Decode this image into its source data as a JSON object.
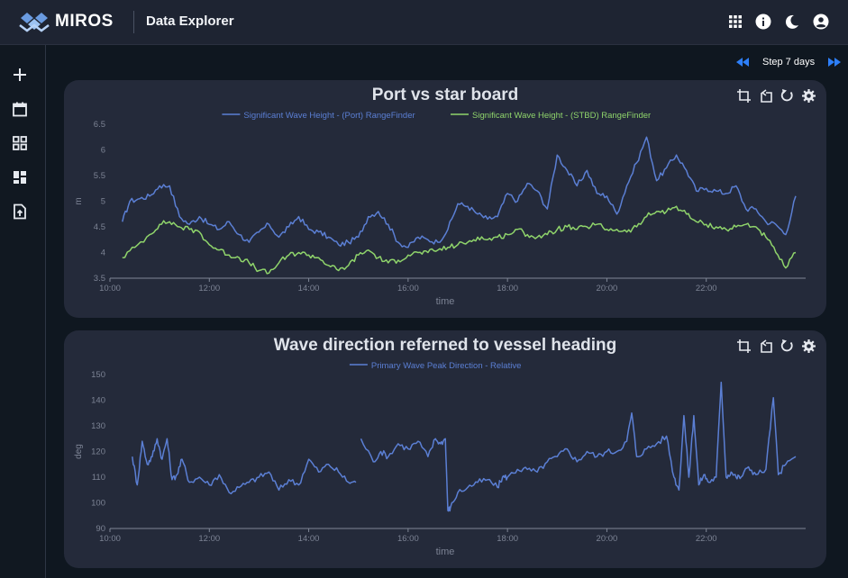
{
  "app": {
    "brand": "MIROS",
    "title": "Data Explorer"
  },
  "header": {
    "icons": [
      "apps-grid-icon",
      "info-icon",
      "dark-mode-moon-icon",
      "account-icon"
    ]
  },
  "sidebar": {
    "items": [
      {
        "icon": "add-icon"
      },
      {
        "icon": "calendar-icon"
      },
      {
        "icon": "grid-view-icon"
      },
      {
        "icon": "dashboard-icon"
      },
      {
        "icon": "upload-file-icon"
      }
    ]
  },
  "step": {
    "label": "Step 7 days"
  },
  "colors": {
    "accent": "#2d7ff9",
    "series_blue": "#5b7fd4",
    "series_green": "#8fd46b",
    "card_bg": "#242a3a",
    "axis_text": "#7c8394"
  },
  "chart_data": [
    {
      "type": "line",
      "title": "Port vs star board",
      "xlabel": "time",
      "ylabel": "m",
      "xlim": [
        10.0,
        24.0
      ],
      "ylim": [
        3.5,
        6.5
      ],
      "x_ticks": [
        "10:00",
        "12:00",
        "14:00",
        "16:00",
        "18:00",
        "20:00",
        "22:00"
      ],
      "y_ticks": [
        "3.5",
        "4",
        "4.5",
        "5",
        "5.5",
        "6",
        "6.5"
      ],
      "legend_position": "top-center",
      "series": [
        {
          "name": "Significant Wave Height - (Port) RangeFinder",
          "color": "#5b7fd4",
          "x": [
            10.25,
            10.4,
            10.6,
            10.8,
            11.0,
            11.2,
            11.4,
            11.6,
            11.8,
            12.0,
            12.2,
            12.4,
            12.6,
            12.8,
            13.0,
            13.2,
            13.4,
            13.6,
            13.8,
            14.0,
            14.2,
            14.4,
            14.6,
            14.8,
            15.0,
            15.2,
            15.4,
            15.6,
            15.8,
            16.0,
            16.2,
            16.4,
            16.6,
            16.8,
            17.0,
            17.2,
            17.4,
            17.6,
            17.8,
            18.0,
            18.2,
            18.4,
            18.6,
            18.8,
            19.0,
            19.2,
            19.4,
            19.6,
            19.8,
            20.0,
            20.2,
            20.4,
            20.6,
            20.8,
            21.0,
            21.2,
            21.4,
            21.6,
            21.8,
            22.0,
            22.2,
            22.4,
            22.6,
            22.8,
            23.0,
            23.2,
            23.4,
            23.6,
            23.8
          ],
          "values": [
            4.6,
            5.0,
            5.05,
            5.1,
            5.3,
            5.3,
            4.7,
            4.55,
            4.7,
            4.55,
            4.45,
            4.6,
            4.35,
            4.2,
            4.4,
            4.55,
            4.3,
            4.5,
            4.7,
            4.45,
            4.4,
            4.3,
            4.15,
            4.2,
            4.3,
            4.7,
            4.8,
            4.55,
            4.2,
            4.1,
            4.3,
            4.25,
            4.2,
            4.45,
            4.95,
            4.9,
            4.75,
            4.65,
            4.7,
            5.15,
            5.0,
            5.35,
            5.2,
            4.85,
            5.9,
            5.6,
            5.3,
            5.6,
            5.15,
            5.1,
            4.75,
            5.3,
            5.75,
            6.25,
            5.4,
            5.65,
            5.9,
            5.6,
            5.2,
            5.25,
            5.2,
            5.15,
            5.3,
            4.85,
            4.85,
            4.6,
            4.55,
            4.35,
            5.1
          ]
        },
        {
          "name": "Significant Wave Height - (STBD) RangeFinder",
          "color": "#8fd46b",
          "x": [
            10.25,
            10.5,
            10.8,
            11.0,
            11.2,
            11.4,
            11.6,
            11.8,
            12.0,
            12.2,
            12.4,
            12.6,
            12.8,
            13.0,
            13.2,
            13.4,
            13.6,
            13.8,
            14.0,
            14.2,
            14.4,
            14.6,
            14.8,
            15.0,
            15.2,
            15.4,
            15.6,
            15.8,
            16.0,
            16.2,
            16.4,
            16.6,
            16.8,
            17.0,
            17.2,
            17.4,
            17.6,
            17.8,
            18.0,
            18.2,
            18.4,
            18.6,
            18.8,
            19.0,
            19.2,
            19.4,
            19.6,
            19.8,
            20.0,
            20.2,
            20.4,
            20.6,
            20.8,
            21.0,
            21.2,
            21.4,
            21.6,
            21.8,
            22.0,
            22.2,
            22.4,
            22.6,
            22.8,
            23.0,
            23.2,
            23.4,
            23.6,
            23.8
          ],
          "values": [
            3.9,
            4.1,
            4.35,
            4.55,
            4.6,
            4.5,
            4.45,
            4.4,
            4.15,
            4.05,
            3.95,
            3.9,
            3.8,
            3.65,
            3.6,
            3.8,
            3.95,
            4.0,
            3.95,
            3.9,
            3.75,
            3.65,
            3.75,
            3.95,
            4.05,
            3.9,
            3.8,
            3.85,
            3.95,
            4.0,
            4.0,
            4.05,
            4.1,
            4.15,
            4.2,
            4.3,
            4.25,
            4.3,
            4.35,
            4.45,
            4.35,
            4.3,
            4.35,
            4.45,
            4.5,
            4.45,
            4.5,
            4.55,
            4.45,
            4.45,
            4.4,
            4.5,
            4.7,
            4.8,
            4.8,
            4.9,
            4.75,
            4.6,
            4.55,
            4.5,
            4.45,
            4.5,
            4.55,
            4.5,
            4.3,
            4.0,
            3.7,
            4.0
          ]
        }
      ]
    },
    {
      "type": "line",
      "title": "Wave direction referned to vessel heading",
      "xlabel": "time",
      "ylabel": "deg",
      "xlim": [
        10.0,
        24.0
      ],
      "ylim": [
        90,
        150
      ],
      "x_ticks": [
        "10:00",
        "12:00",
        "14:00",
        "16:00",
        "18:00",
        "20:00",
        "22:00"
      ],
      "y_ticks": [
        "90",
        "100",
        "110",
        "120",
        "130",
        "140",
        "150"
      ],
      "legend_position": "top-center",
      "series": [
        {
          "name": "Primary Wave Peak Direction - Relative",
          "color": "#5b7fd4",
          "x": [
            10.45,
            10.55,
            10.65,
            10.75,
            10.85,
            10.95,
            11.05,
            11.15,
            11.25,
            11.35,
            11.45,
            11.6,
            11.8,
            12.0,
            12.2,
            12.4,
            12.6,
            12.8,
            13.0,
            13.2,
            13.4,
            13.6,
            13.8,
            14.0,
            14.2,
            14.4,
            14.6,
            14.8,
            14.95,
            15.0,
            15.05,
            15.3,
            15.45,
            15.6,
            15.8,
            16.0,
            16.2,
            16.4,
            16.55,
            16.65,
            16.75,
            16.8,
            16.85,
            17.0,
            17.2,
            17.4,
            17.6,
            17.8,
            17.9,
            18.0,
            18.2,
            18.4,
            18.6,
            18.8,
            19.0,
            19.2,
            19.4,
            19.6,
            19.8,
            20.0,
            20.2,
            20.4,
            20.5,
            20.6,
            20.8,
            21.0,
            21.2,
            21.35,
            21.45,
            21.55,
            21.65,
            21.75,
            21.85,
            21.95,
            22.05,
            22.2,
            22.3,
            22.4,
            22.5,
            22.6,
            22.7,
            22.85,
            23.0,
            23.2,
            23.35,
            23.45,
            23.6,
            23.8
          ],
          "values": [
            118,
            107,
            124,
            115,
            118,
            125,
            117,
            125,
            109,
            111,
            117,
            108,
            110,
            107,
            111,
            104,
            106,
            108,
            110,
            112,
            105,
            109,
            107,
            117,
            112,
            115,
            112,
            108,
            108,
            null,
            125,
            116,
            120,
            118,
            123,
            121,
            124,
            118,
            125,
            123,
            125,
            97,
            98,
            104,
            106,
            108,
            109,
            106,
            110,
            110,
            113,
            113,
            112,
            116,
            118,
            121,
            116,
            120,
            118,
            120,
            120,
            124,
            135,
            118,
            121,
            123,
            126,
            110,
            105,
            134,
            110,
            134,
            107,
            111,
            108,
            110,
            147,
            110,
            112,
            110,
            110,
            114,
            111,
            113,
            141,
            111,
            115,
            118
          ]
        }
      ]
    }
  ]
}
